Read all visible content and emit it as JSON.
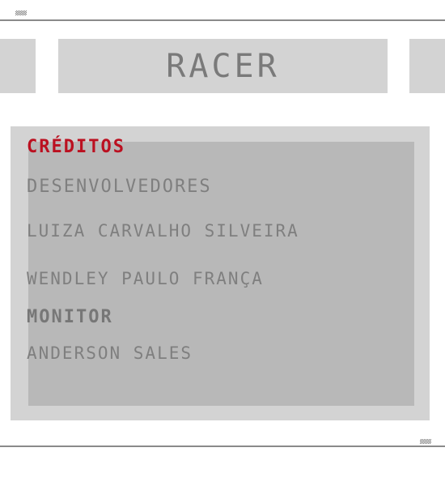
{
  "header": {
    "title": "RACER"
  },
  "credits": {
    "heading": "CRÉDITOS",
    "developers_label": "DESENVOLVEDORES",
    "developers": [
      "LUIZA CARVALHO SILVEIRA",
      "WENDLEY PAULO FRANÇA"
    ],
    "monitor_label": "MONITOR",
    "monitor": "ANDERSON SALES"
  },
  "colors": {
    "heading": "#bb1020",
    "text": "#7f7f7f",
    "panel_outer": "#d3d3d3",
    "panel_inner": "#b8b8b8"
  },
  "icons": {
    "top_marker": "checkered-flag-icon",
    "bottom_marker": "checkered-flag-icon"
  }
}
